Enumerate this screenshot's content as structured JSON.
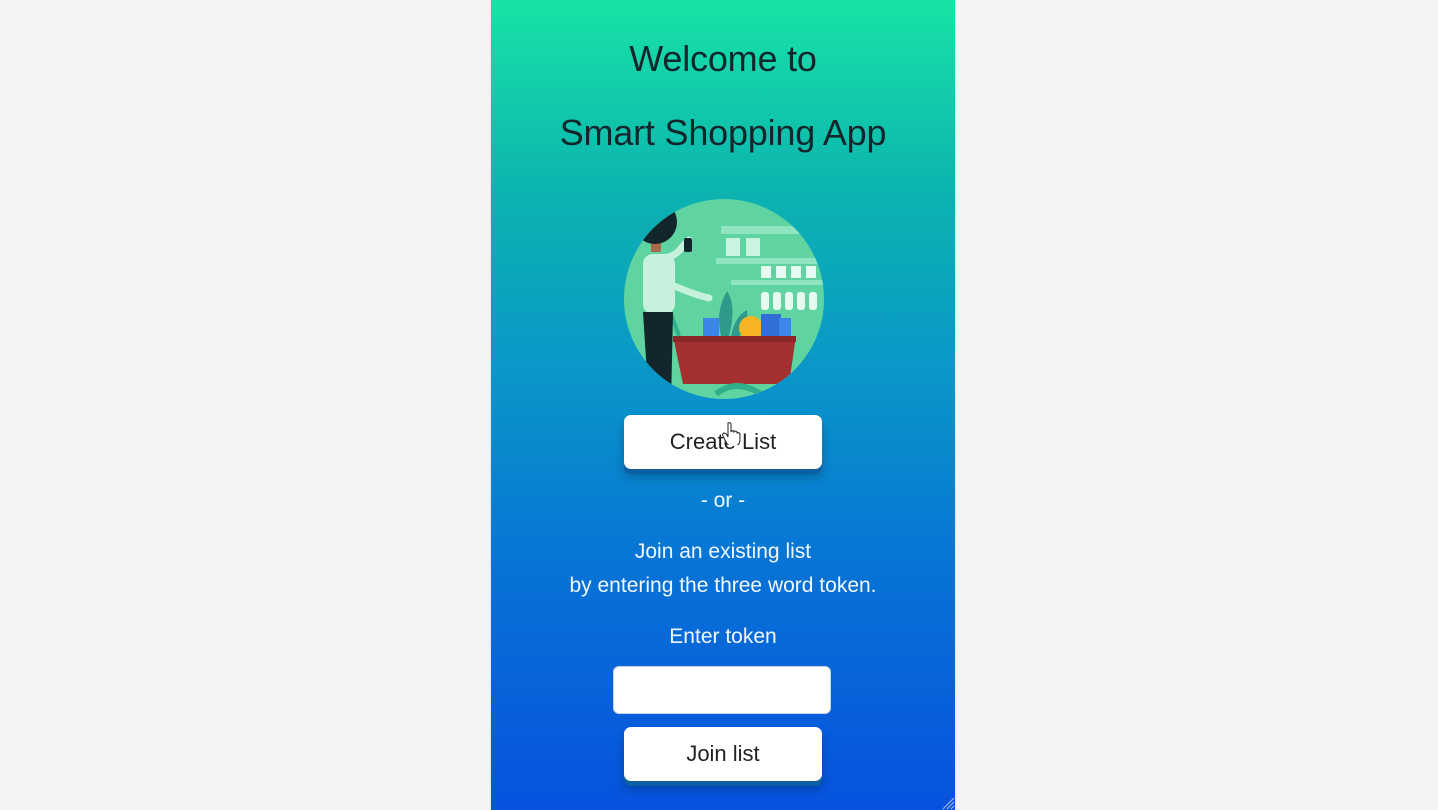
{
  "header": {
    "title_line1": "Welcome to",
    "title_line2": "Smart Shopping App"
  },
  "hero": {
    "illustration": "woman-with-shopping-cart-illustration"
  },
  "actions": {
    "create_label": "Create List",
    "or_text": "- or -",
    "join_instructions_line1": "Join an existing list",
    "join_instructions_line2": "by entering the three word token.",
    "token_label": "Enter token",
    "token_value": "",
    "join_label": "Join list"
  },
  "colors": {
    "gradient_top": "#18e3a6",
    "gradient_bottom": "#0752de",
    "title_text": "#13262b",
    "button_bg": "#ffffff",
    "cart_red": "#a3302f"
  },
  "icons": {
    "cursor": "hand-pointer-icon",
    "resize": "resize-grip-icon"
  }
}
